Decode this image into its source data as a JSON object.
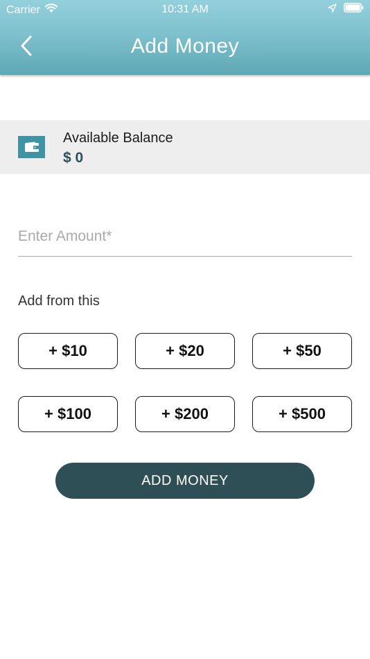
{
  "status_bar": {
    "carrier": "Carrier",
    "time": "10:31 AM",
    "icons": [
      "wifi-icon",
      "location-arrow-icon",
      "battery-icon"
    ]
  },
  "header": {
    "title": "Add Money",
    "back_icon": "chevron-left-icon",
    "gradient_colors": [
      "#93d0dc",
      "#5ea7b4"
    ]
  },
  "balance": {
    "icon": "wallet-icon",
    "icon_color": "#3f93a2",
    "label": "Available Balance",
    "value": "$ 0"
  },
  "amount_input": {
    "placeholder": "Enter Amount*",
    "value": ""
  },
  "quick_add": {
    "label": "Add from this",
    "options": [
      "+ $10",
      "+ $20",
      "+ $50",
      "+ $100",
      "+ $200",
      "+ $500"
    ]
  },
  "submit": {
    "label": "ADD MONEY",
    "color": "#2f4f57"
  }
}
